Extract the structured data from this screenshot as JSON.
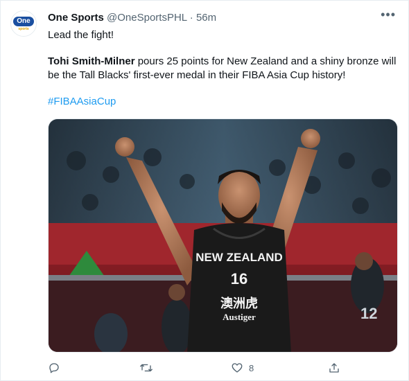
{
  "account": {
    "name": "One Sports",
    "handle": "@OneSportsPHL",
    "separator": "·",
    "time": "56m",
    "avatar_badge": "One",
    "avatar_sub": "sports"
  },
  "tweet": {
    "line1": "Lead the fight!",
    "player": "Tohi Smith-Milner",
    "body": " pours 25 points for New Zealand and a shiny bronze will be the Tall Blacks' first-ever medal in their FIBA Asia Cup history!",
    "hashtag": "#FIBAAsiaCup"
  },
  "media": {
    "jersey_team": "NEW ZEALAND",
    "jersey_number": "16",
    "jersey_sponsor_cn": "澳洲虎",
    "jersey_sponsor": "Austiger",
    "bg_player_number": "12"
  },
  "actions": {
    "reply_icon": "reply-icon",
    "retweet_icon": "retweet-icon",
    "like_icon": "heart-icon",
    "like_count": "8",
    "share_icon": "share-icon"
  },
  "colors": {
    "accent": "#1d9bf0",
    "secondary_text": "#536471",
    "jersey": "#1a1a1a",
    "court_red": "#b3252d"
  }
}
